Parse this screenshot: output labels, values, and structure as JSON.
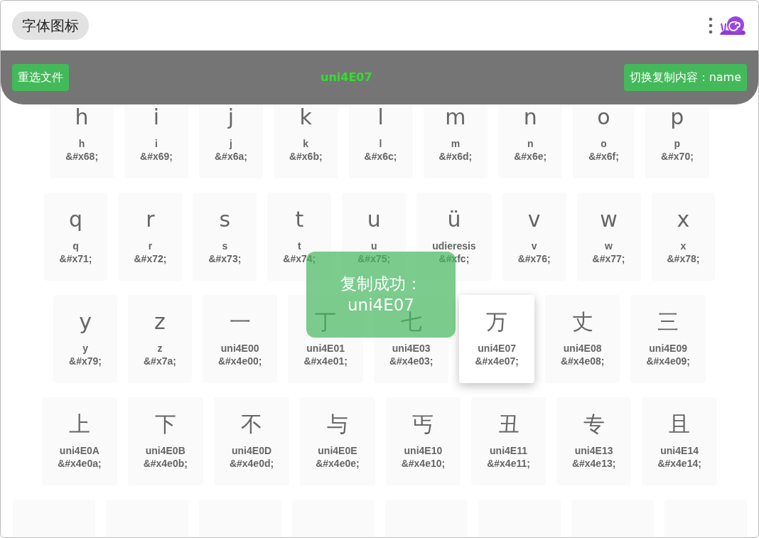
{
  "app_title": "字体图标",
  "toolbar": {
    "reselect_button": "重选文件",
    "current_name": "uni4E07",
    "toggle_button": "切换复制内容：name"
  },
  "rows": [
    [
      {
        "glyph": "h",
        "name": "h",
        "code": "&#x68;",
        "selected": false
      },
      {
        "glyph": "i",
        "name": "i",
        "code": "&#x69;",
        "selected": false
      },
      {
        "glyph": "j",
        "name": "j",
        "code": "&#x6a;",
        "selected": false
      },
      {
        "glyph": "k",
        "name": "k",
        "code": "&#x6b;",
        "selected": false
      },
      {
        "glyph": "l",
        "name": "l",
        "code": "&#x6c;",
        "selected": false
      },
      {
        "glyph": "m",
        "name": "m",
        "code": "&#x6d;",
        "selected": false
      },
      {
        "glyph": "n",
        "name": "n",
        "code": "&#x6e;",
        "selected": false
      },
      {
        "glyph": "o",
        "name": "o",
        "code": "&#x6f;",
        "selected": false
      },
      {
        "glyph": "p",
        "name": "p",
        "code": "&#x70;",
        "selected": false
      }
    ],
    [
      {
        "glyph": "q",
        "name": "q",
        "code": "&#x71;",
        "selected": false
      },
      {
        "glyph": "r",
        "name": "r",
        "code": "&#x72;",
        "selected": false
      },
      {
        "glyph": "s",
        "name": "s",
        "code": "&#x73;",
        "selected": false
      },
      {
        "glyph": "t",
        "name": "t",
        "code": "&#x74;",
        "selected": false
      },
      {
        "glyph": "u",
        "name": "u",
        "code": "&#x75;",
        "selected": false
      },
      {
        "glyph": "ü",
        "name": "udieresis",
        "code": "&#xfc;",
        "selected": false
      },
      {
        "glyph": "v",
        "name": "v",
        "code": "&#x76;",
        "selected": false
      },
      {
        "glyph": "w",
        "name": "w",
        "code": "&#x77;",
        "selected": false
      },
      {
        "glyph": "x",
        "name": "x",
        "code": "&#x78;",
        "selected": false
      }
    ],
    [
      {
        "glyph": "y",
        "name": "y",
        "code": "&#x79;",
        "selected": false
      },
      {
        "glyph": "z",
        "name": "z",
        "code": "&#x7a;",
        "selected": false
      },
      {
        "glyph": "一",
        "name": "uni4E00",
        "code": "&#x4e00;",
        "selected": false
      },
      {
        "glyph": "丁",
        "name": "uni4E01",
        "code": "&#x4e01;",
        "selected": false
      },
      {
        "glyph": "七",
        "name": "uni4E03",
        "code": "&#x4e03;",
        "selected": false
      },
      {
        "glyph": "万",
        "name": "uni4E07",
        "code": "&#x4e07;",
        "selected": true
      },
      {
        "glyph": "丈",
        "name": "uni4E08",
        "code": "&#x4e08;",
        "selected": false
      },
      {
        "glyph": "三",
        "name": "uni4E09",
        "code": "&#x4e09;",
        "selected": false
      }
    ],
    [
      {
        "glyph": "上",
        "name": "uni4E0A",
        "code": "&#x4e0a;",
        "selected": false
      },
      {
        "glyph": "下",
        "name": "uni4E0B",
        "code": "&#x4e0b;",
        "selected": false
      },
      {
        "glyph": "不",
        "name": "uni4E0D",
        "code": "&#x4e0d;",
        "selected": false
      },
      {
        "glyph": "与",
        "name": "uni4E0E",
        "code": "&#x4e0e;",
        "selected": false
      },
      {
        "glyph": "丐",
        "name": "uni4E10",
        "code": "&#x4e10;",
        "selected": false
      },
      {
        "glyph": "丑",
        "name": "uni4E11",
        "code": "&#x4e11;",
        "selected": false
      },
      {
        "glyph": "专",
        "name": "uni4E13",
        "code": "&#x4e13;",
        "selected": false
      },
      {
        "glyph": "且",
        "name": "uni4E14",
        "code": "&#x4e14;",
        "selected": false
      }
    ],
    [
      {
        "selected": false
      },
      {
        "selected": false
      },
      {
        "selected": false
      },
      {
        "selected": false
      },
      {
        "selected": false
      },
      {
        "selected": false
      },
      {
        "selected": false
      },
      {
        "selected": false
      }
    ]
  ],
  "toast": {
    "title": "复制成功：",
    "value": "uni4E07"
  }
}
